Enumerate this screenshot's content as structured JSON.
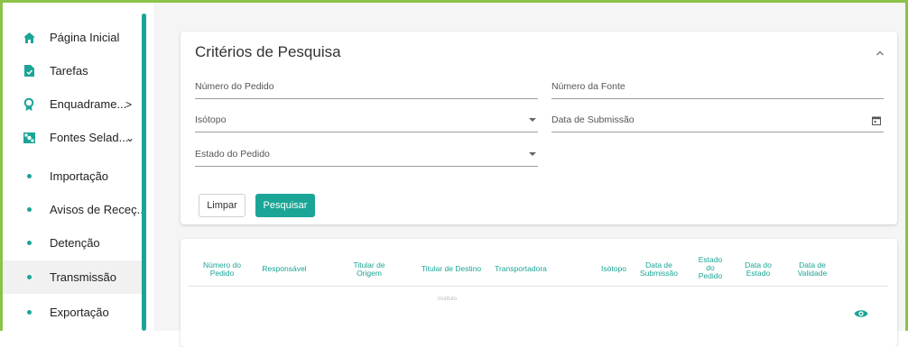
{
  "sidebar": {
    "items": [
      {
        "label": "Página Inicial",
        "icon": "home-icon"
      },
      {
        "label": "Tarefas",
        "icon": "task-icon"
      },
      {
        "label": "Enquadrame...",
        "icon": "badge-icon",
        "chevron": ">"
      },
      {
        "label": "Fontes Selad...",
        "icon": "radiation-source-icon",
        "chevron": "⌄"
      },
      {
        "label": "Importação",
        "icon": "dot-icon"
      },
      {
        "label": "Avisos de Receç...",
        "icon": "dot-icon"
      },
      {
        "label": "Detenção",
        "icon": "dot-icon"
      },
      {
        "label": "Transmissão",
        "icon": "dot-icon",
        "active": true
      },
      {
        "label": "Exportação",
        "icon": "dot-icon"
      }
    ]
  },
  "search": {
    "title": "Critérios de Pesquisa",
    "fields": {
      "order_number": "Número do Pedido",
      "source_number": "Número da Fonte",
      "isotope": "Isótopo",
      "submission_date": "Data de Submissão",
      "order_state": "Estado do Pedido"
    },
    "clear_label": "Limpar",
    "search_label": "Pesquisar"
  },
  "table": {
    "columns": [
      "Número do Pedido",
      "Responsável",
      "Titular de Origem",
      "Titular de Destino",
      "Transportadora",
      "Isótopo",
      "Data de Submissão",
      "Estado do Pedido",
      "Data do Estado",
      "Data de Validade"
    ],
    "ghost_text": "Instituto"
  },
  "colors": {
    "accent": "#1aa596",
    "frame": "#8bc34a"
  }
}
